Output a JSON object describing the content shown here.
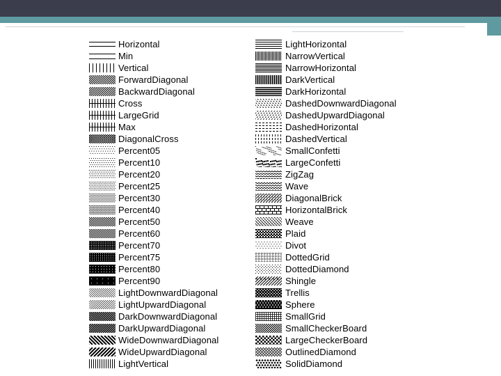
{
  "hatch_styles": {
    "left_column": [
      {
        "label": "Horizontal",
        "pattern": "horizontal"
      },
      {
        "label": "Min",
        "pattern": "min"
      },
      {
        "label": "Vertical",
        "pattern": "vertical"
      },
      {
        "label": "ForwardDiagonal",
        "pattern": "fdiag"
      },
      {
        "label": "BackwardDiagonal",
        "pattern": "bdiag"
      },
      {
        "label": "Cross",
        "pattern": "cross"
      },
      {
        "label": "LargeGrid",
        "pattern": "cross"
      },
      {
        "label": "Max",
        "pattern": "cross"
      },
      {
        "label": "DiagonalCross",
        "pattern": "diagcross"
      },
      {
        "label": "Percent05",
        "pattern": "dots-5"
      },
      {
        "label": "Percent10",
        "pattern": "dots-10"
      },
      {
        "label": "Percent20",
        "pattern": "dots-20"
      },
      {
        "label": "Percent25",
        "pattern": "dots-25"
      },
      {
        "label": "Percent30",
        "pattern": "dots-30"
      },
      {
        "label": "Percent40",
        "pattern": "dots-40"
      },
      {
        "label": "Percent50",
        "pattern": "dots-50"
      },
      {
        "label": "Percent60",
        "pattern": "dots-60"
      },
      {
        "label": "Percent70",
        "pattern": "dots-70"
      },
      {
        "label": "Percent75",
        "pattern": "dots-75"
      },
      {
        "label": "Percent80",
        "pattern": "dots-80"
      },
      {
        "label": "Percent90",
        "pattern": "dots-90"
      },
      {
        "label": "LightDownwardDiagonal",
        "pattern": "fdiag-light"
      },
      {
        "label": "LightUpwardDiagonal",
        "pattern": "bdiag-light"
      },
      {
        "label": "DarkDownwardDiagonal",
        "pattern": "fdiag-dark"
      },
      {
        "label": "DarkUpwardDiagonal",
        "pattern": "bdiag-dark"
      },
      {
        "label": "WideDownwardDiagonal",
        "pattern": "fdiag-wide"
      },
      {
        "label": "WideUpwardDiagonal",
        "pattern": "bdiag-wide"
      },
      {
        "label": "LightVertical",
        "pattern": "vertical-light"
      }
    ],
    "right_column": [
      {
        "label": "LightHorizontal",
        "pattern": "horizontal-light"
      },
      {
        "label": "NarrowVertical",
        "pattern": "vertical-narrow"
      },
      {
        "label": "NarrowHorizontal",
        "pattern": "horizontal-narrow"
      },
      {
        "label": "DarkVertical",
        "pattern": "vertical-dark"
      },
      {
        "label": "DarkHorizontal",
        "pattern": "horizontal-dark"
      },
      {
        "label": "DashedDownwardDiagonal",
        "pattern": "dashed-fdiag"
      },
      {
        "label": "DashedUpwardDiagonal",
        "pattern": "dashed-bdiag"
      },
      {
        "label": "DashedHorizontal",
        "pattern": "dashed-horizontal"
      },
      {
        "label": "DashedVertical",
        "pattern": "dashed-vertical"
      },
      {
        "label": "SmallConfetti",
        "pattern": "confetti-small"
      },
      {
        "label": "LargeConfetti",
        "pattern": "confetti-large"
      },
      {
        "label": "ZigZag",
        "pattern": "zigzag"
      },
      {
        "label": "Wave",
        "pattern": "wave"
      },
      {
        "label": "DiagonalBrick",
        "pattern": "diagbrick"
      },
      {
        "label": "HorizontalBrick",
        "pattern": "horizbrick"
      },
      {
        "label": "Weave",
        "pattern": "weave"
      },
      {
        "label": "Plaid",
        "pattern": "plaid"
      },
      {
        "label": "Divot",
        "pattern": "divot"
      },
      {
        "label": "DottedGrid",
        "pattern": "dottedgrid"
      },
      {
        "label": "DottedDiamond",
        "pattern": "dotteddiamond"
      },
      {
        "label": "Shingle",
        "pattern": "shingle"
      },
      {
        "label": "Trellis",
        "pattern": "trellis"
      },
      {
        "label": "Sphere",
        "pattern": "sphere"
      },
      {
        "label": "SmallGrid",
        "pattern": "smallgrid"
      },
      {
        "label": "SmallCheckerBoard",
        "pattern": "smallchecker"
      },
      {
        "label": "LargeCheckerBoard",
        "pattern": "largechecker"
      },
      {
        "label": "OutlinedDiamond",
        "pattern": "outlineddiamond"
      },
      {
        "label": "SolidDiamond",
        "pattern": "soliddiamond"
      }
    ]
  },
  "colors": {
    "header_dark": "#3b3c4c",
    "header_teal": "#5f9aa1",
    "pattern_ink": "#000000"
  }
}
